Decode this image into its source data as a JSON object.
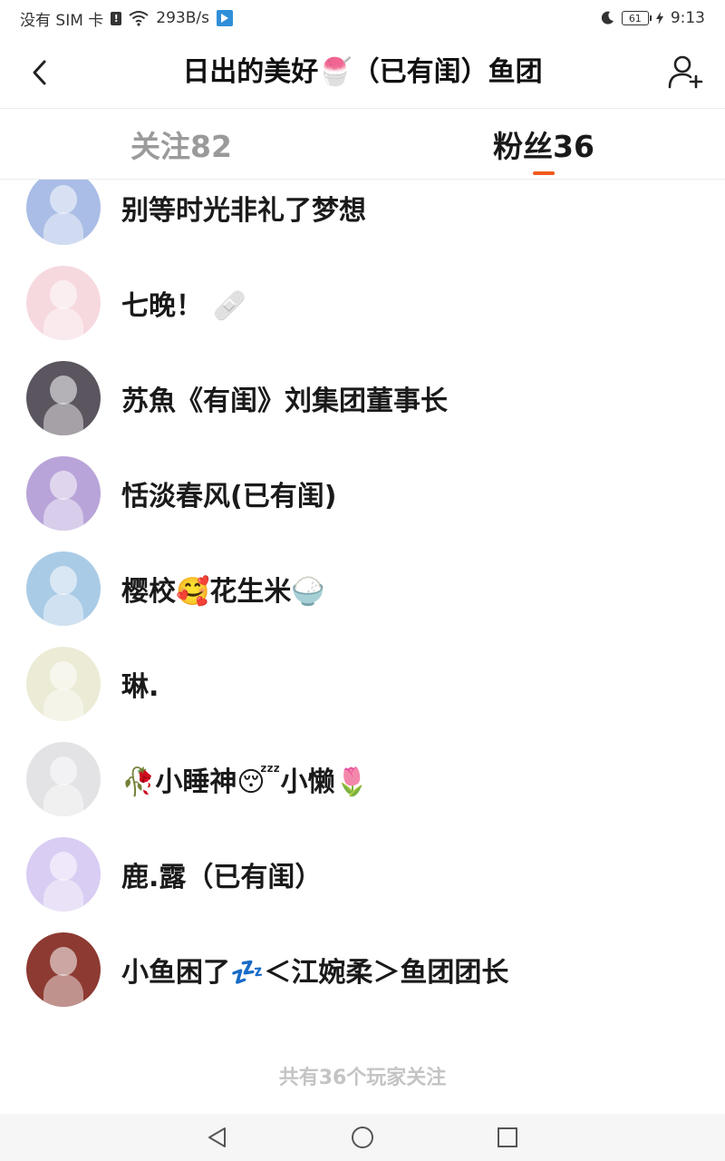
{
  "status_bar": {
    "sim_text": "没有 SIM 卡",
    "net_speed": "293B/s",
    "battery": "61",
    "time": "9:13"
  },
  "header": {
    "title": "日出的美好🍧（已有闺）鱼团"
  },
  "tabs": [
    {
      "label": "关注82",
      "active": false
    },
    {
      "label": "粉丝36",
      "active": true
    }
  ],
  "accent_color": "#f05a1e",
  "followers": [
    {
      "name": "别等时光非礼了梦想",
      "avatar_color": "#a9bde6"
    },
    {
      "name": "七晚！  🩹",
      "avatar_color": "#f6d9df"
    },
    {
      "name": "苏魚《有闺》刘集团董事长",
      "avatar_color": "#5b5560"
    },
    {
      "name": "恬淡春风(已有闺)",
      "avatar_color": "#b9a4d9"
    },
    {
      "name": "樱校🥰花生米🍚",
      "avatar_color": "#aacbe6"
    },
    {
      "name": "琳.",
      "avatar_color": "#ecebd6"
    },
    {
      "name": "🥀小睡神😴小懒🌷",
      "avatar_color": "#e3e3e6"
    },
    {
      "name": "鹿.露（已有闺）",
      "avatar_color": "#d9cdf3"
    },
    {
      "name": "小鱼困了💤＜江婉柔＞鱼团团长",
      "avatar_color": "#8d3a32"
    }
  ],
  "footer_text": "共有36个玩家关注"
}
